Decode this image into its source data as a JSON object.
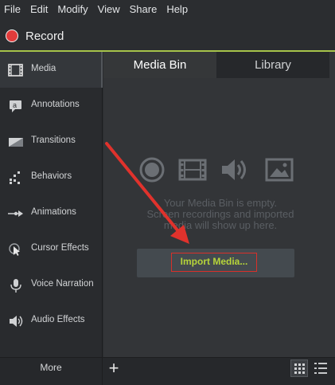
{
  "menu": {
    "items": [
      {
        "label": "File"
      },
      {
        "label": "Edit"
      },
      {
        "label": "Modify"
      },
      {
        "label": "View"
      },
      {
        "label": "Share"
      },
      {
        "label": "Help"
      }
    ]
  },
  "record": {
    "label": "Record"
  },
  "sidebar": {
    "items": [
      {
        "label": "Media",
        "icon": "film-strip-icon",
        "active": true
      },
      {
        "label": "Annotations",
        "icon": "annotation-icon"
      },
      {
        "label": "Transitions",
        "icon": "transition-icon"
      },
      {
        "label": "Behaviors",
        "icon": "behaviors-icon"
      },
      {
        "label": "Animations",
        "icon": "animation-arrow-icon"
      },
      {
        "label": "Cursor Effects",
        "icon": "cursor-icon"
      },
      {
        "label": "Voice Narration",
        "icon": "microphone-icon"
      },
      {
        "label": "Audio Effects",
        "icon": "speaker-icon"
      }
    ],
    "more_label": "More"
  },
  "tabs": [
    {
      "label": "Media Bin",
      "active": true
    },
    {
      "label": "Library",
      "active": false
    }
  ],
  "media_bin": {
    "empty_line1": "Your Media Bin is empty.",
    "empty_line2": "Screen recordings and imported",
    "empty_line3": "media will show up here.",
    "import_button": "Import Media..."
  },
  "colors": {
    "accent_green": "#a6c34a",
    "record_red": "#e23b3b",
    "annotation_red": "#e0322c",
    "import_text": "#b6d43a"
  }
}
